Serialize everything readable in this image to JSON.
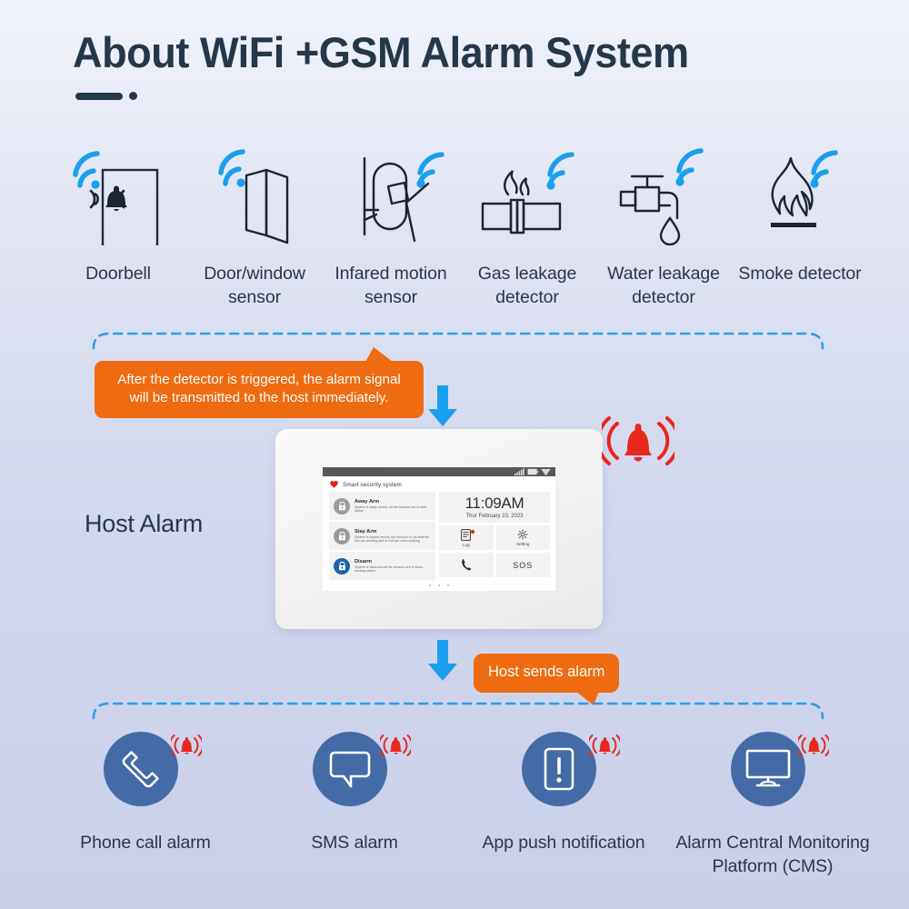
{
  "page": {
    "title": "About WiFi +GSM Alarm System",
    "host_label": "Host Alarm"
  },
  "colors": {
    "accent_orange": "#ef6b11",
    "accent_blue": "#1a9fee",
    "circle_blue": "#456ba6",
    "alarm_red": "#e8271d",
    "title_navy": "#24384a"
  },
  "sensors": [
    {
      "icon": "doorbell-icon",
      "label": "Doorbell"
    },
    {
      "icon": "door-window-sensor-icon",
      "label": "Door/window sensor"
    },
    {
      "icon": "infrared-motion-sensor-icon",
      "label": "Infared motion sensor"
    },
    {
      "icon": "gas-leakage-detector-icon",
      "label": "Gas leakage detector"
    },
    {
      "icon": "water-leakage-detector-icon",
      "label": "Water leakage detector"
    },
    {
      "icon": "smoke-detector-icon",
      "label": "Smoke detector"
    }
  ],
  "callouts": {
    "detector_triggered": "After the detector is triggered, the alarm signal will be transmitted to the host immediately.",
    "host_sends_alarm": "Host sends alarm"
  },
  "device": {
    "brand": "Smart security system",
    "status_icons": [
      "signal-bars-icon",
      "battery-icon",
      "wifi-icon"
    ],
    "modes": [
      {
        "name": "Away Arm",
        "description": "System is away armed, all the sensors are in alert status",
        "icon": "lock-icon",
        "active": false
      },
      {
        "name": "Stay Arm",
        "description": "System is stayed armed, the sensors in 1st defense line are working and in 2nd are none-working",
        "icon": "lock-icon",
        "active": false
      },
      {
        "name": "Disarm",
        "description": "System is disarmed,all the sensors are in None-working status",
        "icon": "unlock-icon",
        "active": true
      }
    ],
    "clock": {
      "time": "11:09AM",
      "date": "Thur February 23, 2023"
    },
    "buttons": [
      {
        "label": "Log",
        "icon": "log-icon",
        "badge": true
      },
      {
        "label": "Setting",
        "icon": "gear-icon",
        "badge": false
      },
      {
        "label": "",
        "icon": "phone-icon",
        "badge": false
      },
      {
        "label": "SOS",
        "icon": "sos-text",
        "badge": false
      }
    ],
    "page_dots": 3
  },
  "outputs": [
    {
      "icon": "phone-handset-icon",
      "label": "Phone call alarm"
    },
    {
      "icon": "speech-bubble-icon",
      "label": "SMS alarm"
    },
    {
      "icon": "smartphone-alert-icon",
      "label": "App push notification"
    },
    {
      "icon": "monitor-icon",
      "label": "Alarm Central Monitoring Platform (CMS)"
    }
  ]
}
